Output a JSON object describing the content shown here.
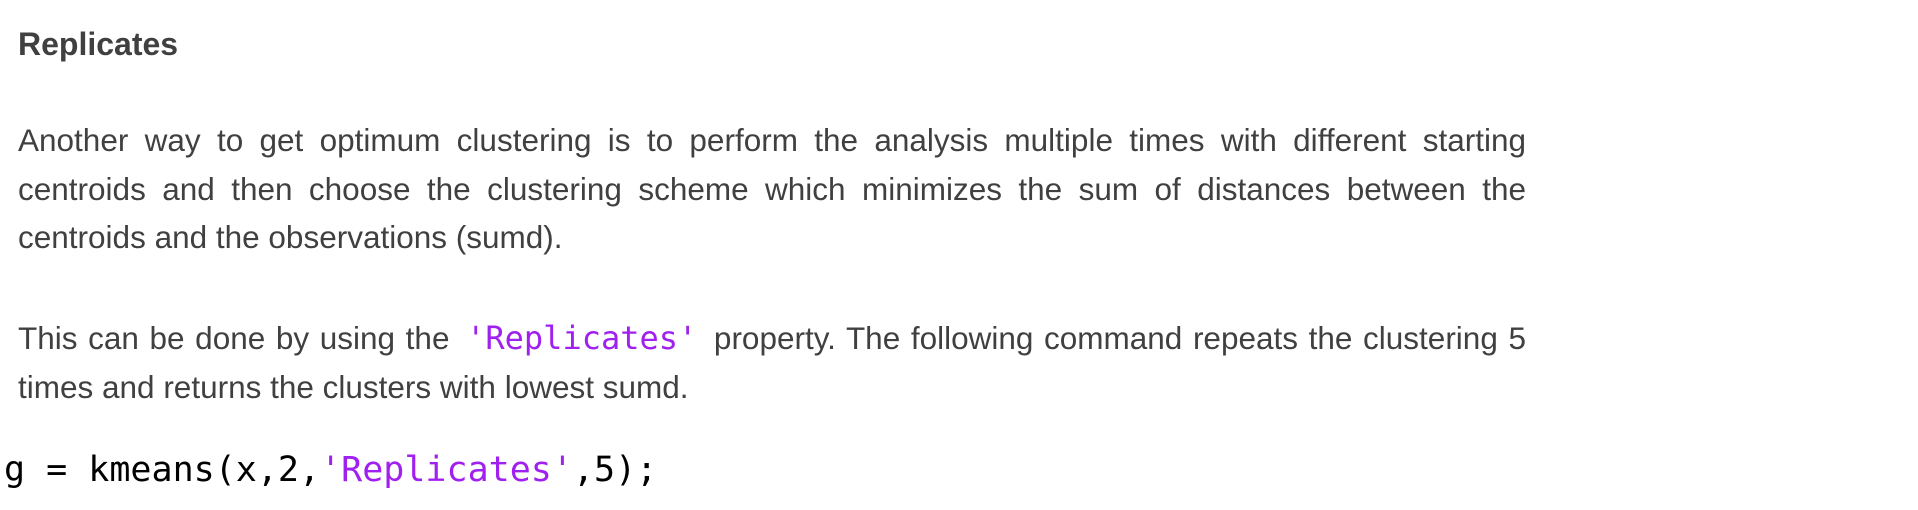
{
  "section": {
    "title": "Replicates"
  },
  "paragraph1": {
    "text": "Another way to get optimum clustering is to perform the analysis multiple times with different starting centroids and then choose the clustering scheme which minimizes the sum of distances between the centroids and the observations (sumd)."
  },
  "paragraph2": {
    "before": "This can be done by using the",
    "code": "'Replicates'",
    "after": "property. The following command repeats the clustering 5 times and returns the clusters with lowest sumd."
  },
  "code_example": {
    "prefix": "g = kmeans(x,2,",
    "string": "'Replicates'",
    "suffix": ",5);"
  },
  "colors": {
    "text": "#404040",
    "code_string": "#a020f0",
    "code_text": "#000000"
  }
}
